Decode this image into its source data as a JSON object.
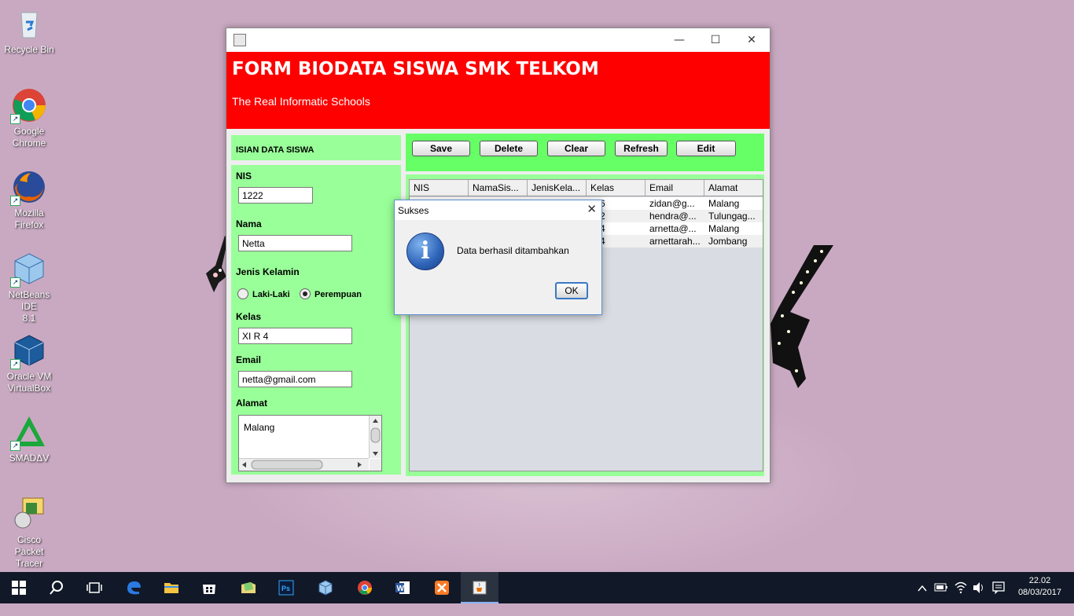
{
  "desktop": {
    "icons": [
      {
        "label_line1": "Recycle Bin",
        "label_line2": ""
      },
      {
        "label_line1": "Google",
        "label_line2": "Chrome"
      },
      {
        "label_line1": "Mozilla",
        "label_line2": "Firefox"
      },
      {
        "label_line1": "NetBeans IDE",
        "label_line2": "8.1"
      },
      {
        "label_line1": "Oracle VM",
        "label_line2": "VirtualBox"
      },
      {
        "label_line1": "SMADΔV",
        "label_line2": ""
      },
      {
        "label_line1": "Cisco Packet",
        "label_line2": "Tracer"
      }
    ]
  },
  "window": {
    "header_title": "FORM BIODATA SISWA SMK TELKOM",
    "header_subtitle": "The Real Informatic Schools",
    "minimize": "—",
    "maximize": "☐",
    "close": "✕"
  },
  "form": {
    "section_title": "ISIAN DATA SISWA",
    "nis_label": "NIS",
    "nis_value": "1222",
    "nama_label": "Nama",
    "nama_value": "Netta",
    "jk_label": "Jenis Kelamin",
    "jk_options": [
      "Laki-Laki",
      "Perempuan"
    ],
    "jk_selected": "Perempuan",
    "kelas_label": "Kelas",
    "kelas_value": "XI R 4",
    "email_label": "Email",
    "email_value": "netta@gmail.com",
    "alamat_label": "Alamat",
    "alamat_value": "Malang"
  },
  "toolbar": {
    "save": "Save",
    "delete": "Delete",
    "clear": "Clear",
    "refresh": "Refresh",
    "edit": "Edit"
  },
  "table": {
    "columns": [
      "NIS",
      "NamaSis...",
      "JenisKela...",
      "Kelas",
      "Email",
      "Alamat"
    ],
    "rows": [
      [
        "",
        "",
        "",
        "R 6",
        "zidan@g...",
        "Malang"
      ],
      [
        "",
        "",
        "",
        "R 2",
        "hendra@...",
        "Tulungag..."
      ],
      [
        "",
        "",
        "",
        "R 4",
        "arnetta@...",
        "Malang"
      ],
      [
        "",
        "",
        "",
        "R 4",
        "arnettarah...",
        "Jombang"
      ]
    ]
  },
  "dialog": {
    "title": "Sukses",
    "message": "Data berhasil ditambahkan",
    "ok": "OK",
    "close": "✕"
  },
  "taskbar": {
    "clock_time": "22.02",
    "clock_date": "08/03/2017",
    "items": [
      "windows-start",
      "search",
      "task-view",
      "edge",
      "file-explorer",
      "store",
      "notepad-folder",
      "photoshop",
      "virtualbox",
      "chrome",
      "word",
      "xampp",
      "java-app"
    ]
  }
}
